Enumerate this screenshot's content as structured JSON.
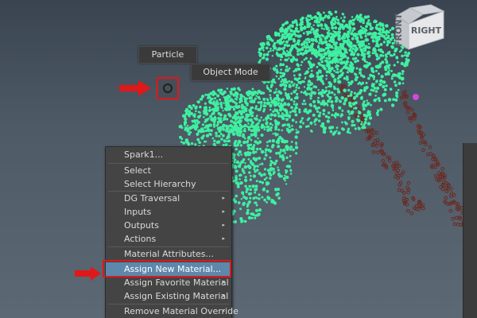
{
  "viewcube": {
    "face_label": "RIGHT",
    "side_label": "FRONT"
  },
  "marking_menu": {
    "north_label": "Particle",
    "northeast_label": "Object Mode"
  },
  "context_menu": {
    "items": [
      {
        "label": "Spark1...",
        "submenu": false
      },
      {
        "label": "Select",
        "submenu": false
      },
      {
        "label": "Select Hierarchy",
        "submenu": false
      },
      {
        "label": "DG Traversal",
        "submenu": true
      },
      {
        "label": "Inputs",
        "submenu": true
      },
      {
        "label": "Outputs",
        "submenu": true
      },
      {
        "label": "Actions",
        "submenu": true
      },
      {
        "label": "Material Attributes...",
        "submenu": false
      },
      {
        "label": "Assign New Material...",
        "submenu": false,
        "highlighted": true
      },
      {
        "label": "Assign Favorite Material",
        "submenu": true
      },
      {
        "label": "Assign Existing Material",
        "submenu": true
      },
      {
        "label": "Remove Material Override",
        "submenu": true
      }
    ],
    "submenu_glyph": "▸"
  },
  "colors": {
    "particles": "#3ff0a0",
    "trail": "#6b2a22",
    "highlight": "#5e88ab",
    "callout": "#e01818",
    "selected_pivot": "#d24ad8"
  },
  "icons": {
    "pivot": "circle-icon",
    "callouts": "arrow-right-icon"
  }
}
